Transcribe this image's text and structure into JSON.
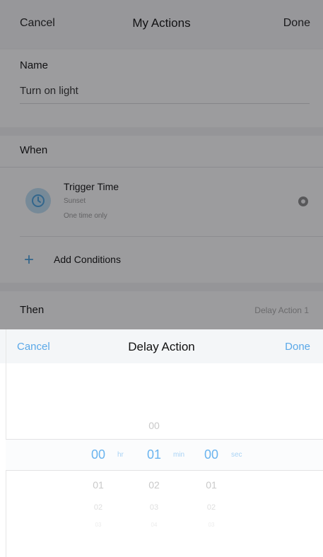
{
  "editor": {
    "nav": {
      "cancel": "Cancel",
      "title": "My Actions",
      "done": "Done"
    },
    "name_section": {
      "label": "Name",
      "value": "Turn on light"
    },
    "when_section": {
      "label": "When",
      "trigger": {
        "title": "Trigger Time",
        "subtitle": "Sunset",
        "detail": "One time only"
      },
      "add_conditions": "Add Conditions"
    },
    "then_section": {
      "label": "Then",
      "right_text": "Delay Action 1"
    }
  },
  "sheet": {
    "cancel": "Cancel",
    "title": "Delay Action",
    "done": "Done",
    "picker": {
      "hours": {
        "selected": "00",
        "below": [
          "01",
          "02",
          "03"
        ],
        "unit": "hr"
      },
      "minutes": {
        "above": "00",
        "selected": "01",
        "below": [
          "02",
          "03",
          "04"
        ],
        "unit": "min"
      },
      "seconds": {
        "selected": "00",
        "below": [
          "01",
          "02",
          "03"
        ],
        "unit": "sec"
      }
    }
  },
  "colors": {
    "accent": "#5aa8e8",
    "selected_value": "#6ab4ef",
    "overlay": "#141419"
  }
}
